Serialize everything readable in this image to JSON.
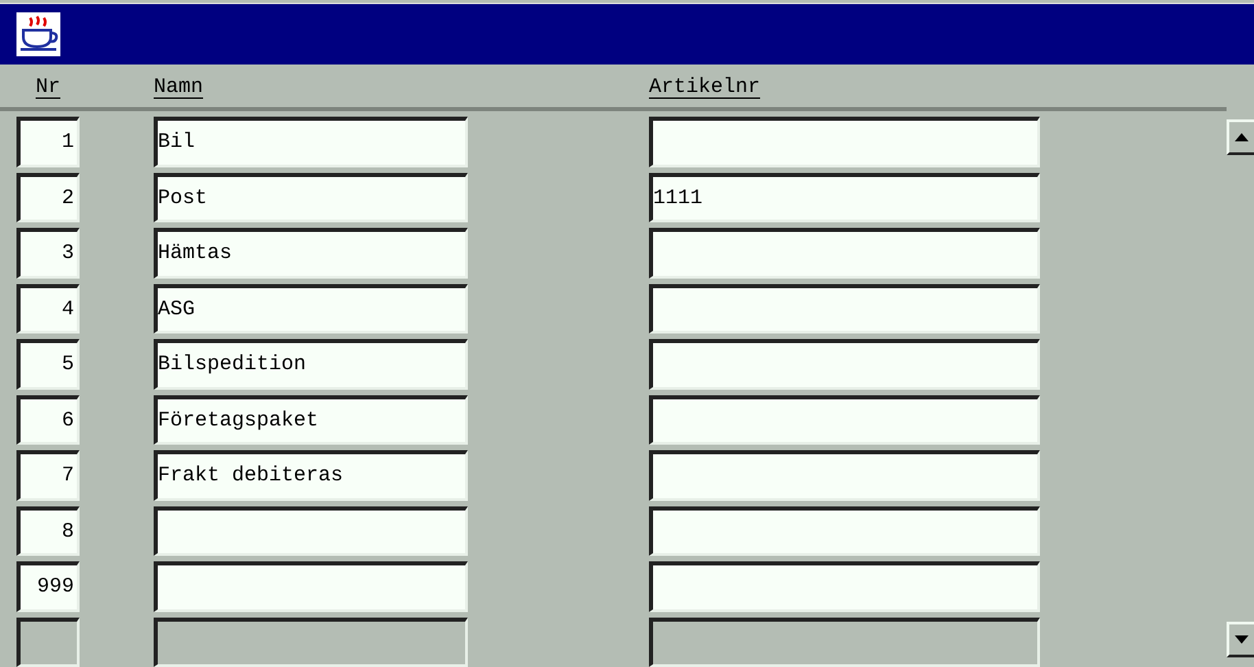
{
  "table": {
    "columns": [
      "Nr",
      "Namn",
      "Artikelnr"
    ],
    "rows": [
      {
        "nr": "1",
        "namn": "Bil",
        "artikelnr": "",
        "disabled": false
      },
      {
        "nr": "2",
        "namn": "Post",
        "artikelnr": "1111",
        "disabled": false
      },
      {
        "nr": "3",
        "namn": "Hämtas",
        "artikelnr": "",
        "disabled": false
      },
      {
        "nr": "4",
        "namn": "ASG",
        "artikelnr": "",
        "disabled": false
      },
      {
        "nr": "5",
        "namn": "Bilspedition",
        "artikelnr": "",
        "disabled": false
      },
      {
        "nr": "6",
        "namn": "Företagspaket",
        "artikelnr": "",
        "disabled": false
      },
      {
        "nr": "7",
        "namn": "Frakt debiteras",
        "artikelnr": "",
        "disabled": false
      },
      {
        "nr": "8",
        "namn": "",
        "artikelnr": "",
        "disabled": false
      },
      {
        "nr": "999",
        "namn": "",
        "artikelnr": "",
        "disabled": false
      },
      {
        "nr": "",
        "namn": "",
        "artikelnr": "",
        "disabled": true
      }
    ]
  }
}
